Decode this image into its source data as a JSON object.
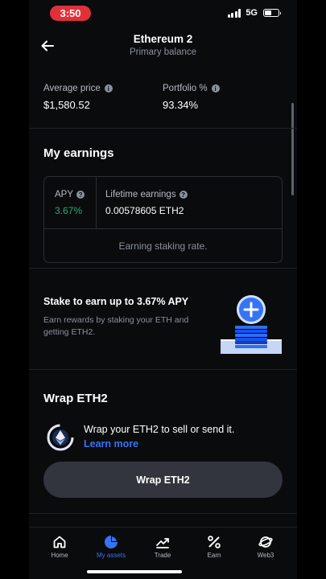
{
  "status_bar": {
    "time": "3:50",
    "network": "5G"
  },
  "header": {
    "title": "Ethereum 2",
    "subtitle": "Primary balance"
  },
  "stats": {
    "average_price_label": "Average price",
    "average_price_value": "$1,580.52",
    "portfolio_label": "Portfolio %",
    "portfolio_value": "93.34%"
  },
  "earnings": {
    "title": "My earnings",
    "apy_label": "APY",
    "apy_value": "3.67%",
    "lifetime_label": "Lifetime earnings",
    "lifetime_value": "0.00578605 ETH2",
    "footer": "Earning staking rate."
  },
  "stake": {
    "title": "Stake to earn up to 3.67% APY",
    "description": "Earn rewards by staking your ETH and getting ETH2."
  },
  "wrap": {
    "title": "Wrap ETH2",
    "text": "Wrap your ETH2 to sell or send it.",
    "learn_more": "Learn more",
    "button": "Wrap ETH2"
  },
  "nav": {
    "home": "Home",
    "my_assets": "My assets",
    "trade": "Trade",
    "earn": "Earn",
    "web3": "Web3",
    "active": "my_assets"
  },
  "icons": {
    "back": "arrow-left-icon",
    "info": "info-icon",
    "home": "home-icon",
    "assets": "pie-chart-icon",
    "trade": "trend-icon",
    "earn": "percent-icon",
    "web3": "globe-orbit-icon"
  },
  "colors": {
    "accent": "#3773f5",
    "positive": "#27ad75",
    "status_time_pill": "#e0313a",
    "background": "#0a0b0d"
  }
}
